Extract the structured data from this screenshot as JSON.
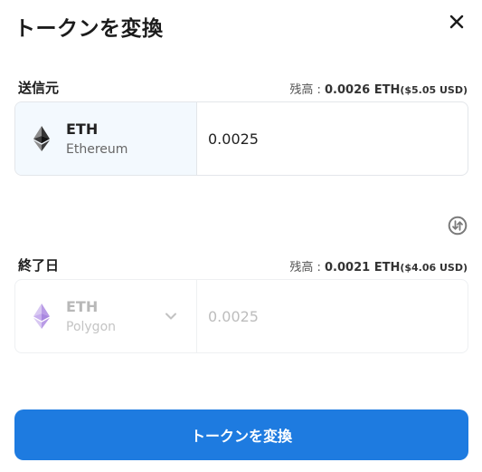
{
  "dialog": {
    "title": "トークンを変換",
    "close_icon": "close-icon"
  },
  "from": {
    "label": "送信元",
    "balance_label": "残高 : ",
    "balance_value": "0.0026 ETH",
    "balance_usd": "($5.05 USD)",
    "token_symbol": "ETH",
    "token_network": "Ethereum",
    "token_icon": "ethereum-icon",
    "amount": "0.0025"
  },
  "swap_icon": "swap-direction-icon",
  "to": {
    "label": "終了日",
    "balance_label": "残高 : ",
    "balance_value": "0.0021 ETH",
    "balance_usd": "($4.06 USD)",
    "token_symbol": "ETH",
    "token_network": "Polygon",
    "token_icon": "ethereum-purple-icon",
    "amount": "0.0025"
  },
  "submit": {
    "label": "トークンを変換"
  },
  "colors": {
    "primary": "#1e7be0",
    "from_select_bg": "#f3f9fe",
    "border": "#e3e6ea"
  }
}
